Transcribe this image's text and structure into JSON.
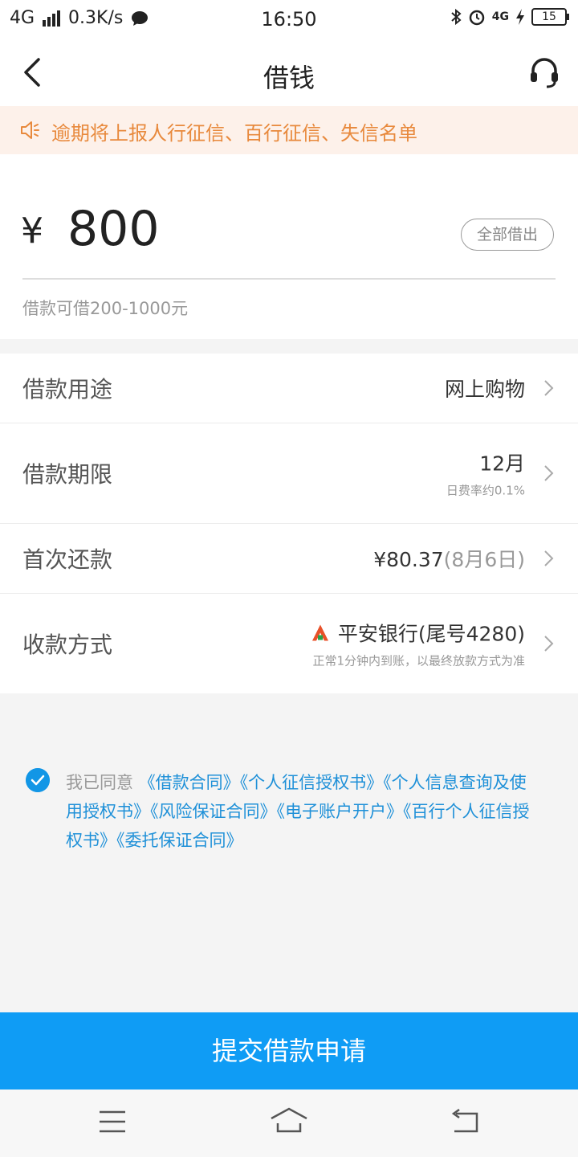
{
  "status_bar": {
    "network": "4G",
    "speed": "0.3K/s",
    "time": "16:50",
    "right_net": "4G",
    "battery": "15"
  },
  "navbar": {
    "title": "借钱",
    "back_icon": "chevron-left-icon",
    "service_icon": "headset-icon"
  },
  "notice": {
    "icon": "speaker-icon",
    "text": "逾期将上报人行征信、百行征信、失信名单"
  },
  "amount": {
    "currency": "¥",
    "value": "800",
    "all_button": "全部借出",
    "hint": "借款可借200-1000元"
  },
  "rows": [
    {
      "label": "借款用途",
      "value": "网上购物"
    },
    {
      "label": "借款期限",
      "value": "12月",
      "sub": "日费率约0.1%"
    },
    {
      "label": "首次还款",
      "value": "¥80.37",
      "value_grey": "(8月6日)"
    },
    {
      "label": "收款方式",
      "value": "平安银行(尾号4280)",
      "sub": "正常1分钟内到账，以最终放款方式为准",
      "icon": "bank-logo-icon"
    }
  ],
  "agreement": {
    "checked": true,
    "prefix": "我已同意",
    "links": [
      "《借款合同》",
      "《个人征信授权书》",
      "《个人信息查询及使用授权书》",
      "《风险保证合同》",
      "《电子账户开户》",
      "《百行个人征信授权书》",
      "《委托保证合同》"
    ]
  },
  "submit": {
    "label": "提交借款申请"
  },
  "colors": {
    "primary": "#0f9cf5",
    "notice_bg": "#fdf1ea",
    "notice_text": "#e8893c",
    "link": "#1e90d8"
  }
}
